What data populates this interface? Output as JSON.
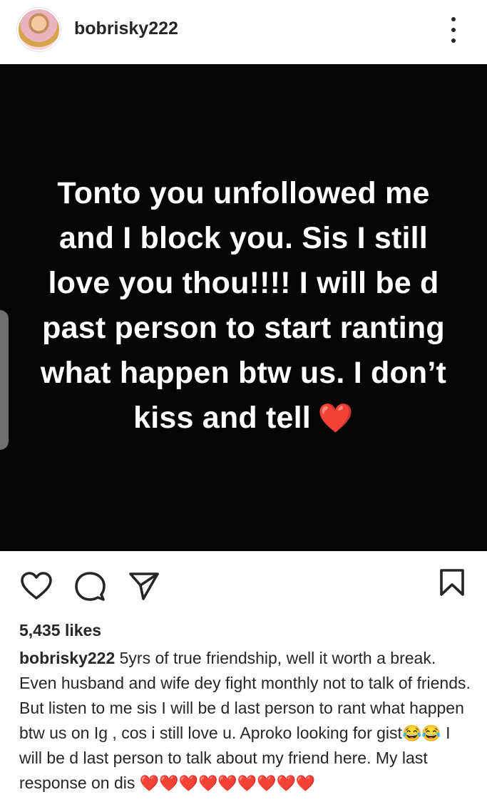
{
  "header": {
    "username": "bobrisky222"
  },
  "post": {
    "text": "Tonto you unfollowed me and I block you. Sis I still love you thou!!!!  I will be d past person to start ranting what happen btw us. I don’t kiss and tell",
    "heart": "❤️"
  },
  "actions": {
    "like_icon": "heart-outline-icon",
    "comment_icon": "comment-icon",
    "share_icon": "send-icon",
    "save_icon": "bookmark-icon"
  },
  "likes": "5,435 likes",
  "caption": {
    "username": "bobrisky222",
    "text_part1": "5yrs of true friendship, well it worth a break. Even husband and wife dey fight monthly not to talk of friends. But listen to me sis I will be d last person to rant what happen btw us on Ig , cos i still love u. Aproko looking for gist",
    "laugh_emojis": "😂😂",
    "text_part2": " I will be d last person to talk about my friend here. My last response on dis ",
    "hearts": "❤️❤️❤️❤️❤️❤️❤️❤️❤️"
  }
}
